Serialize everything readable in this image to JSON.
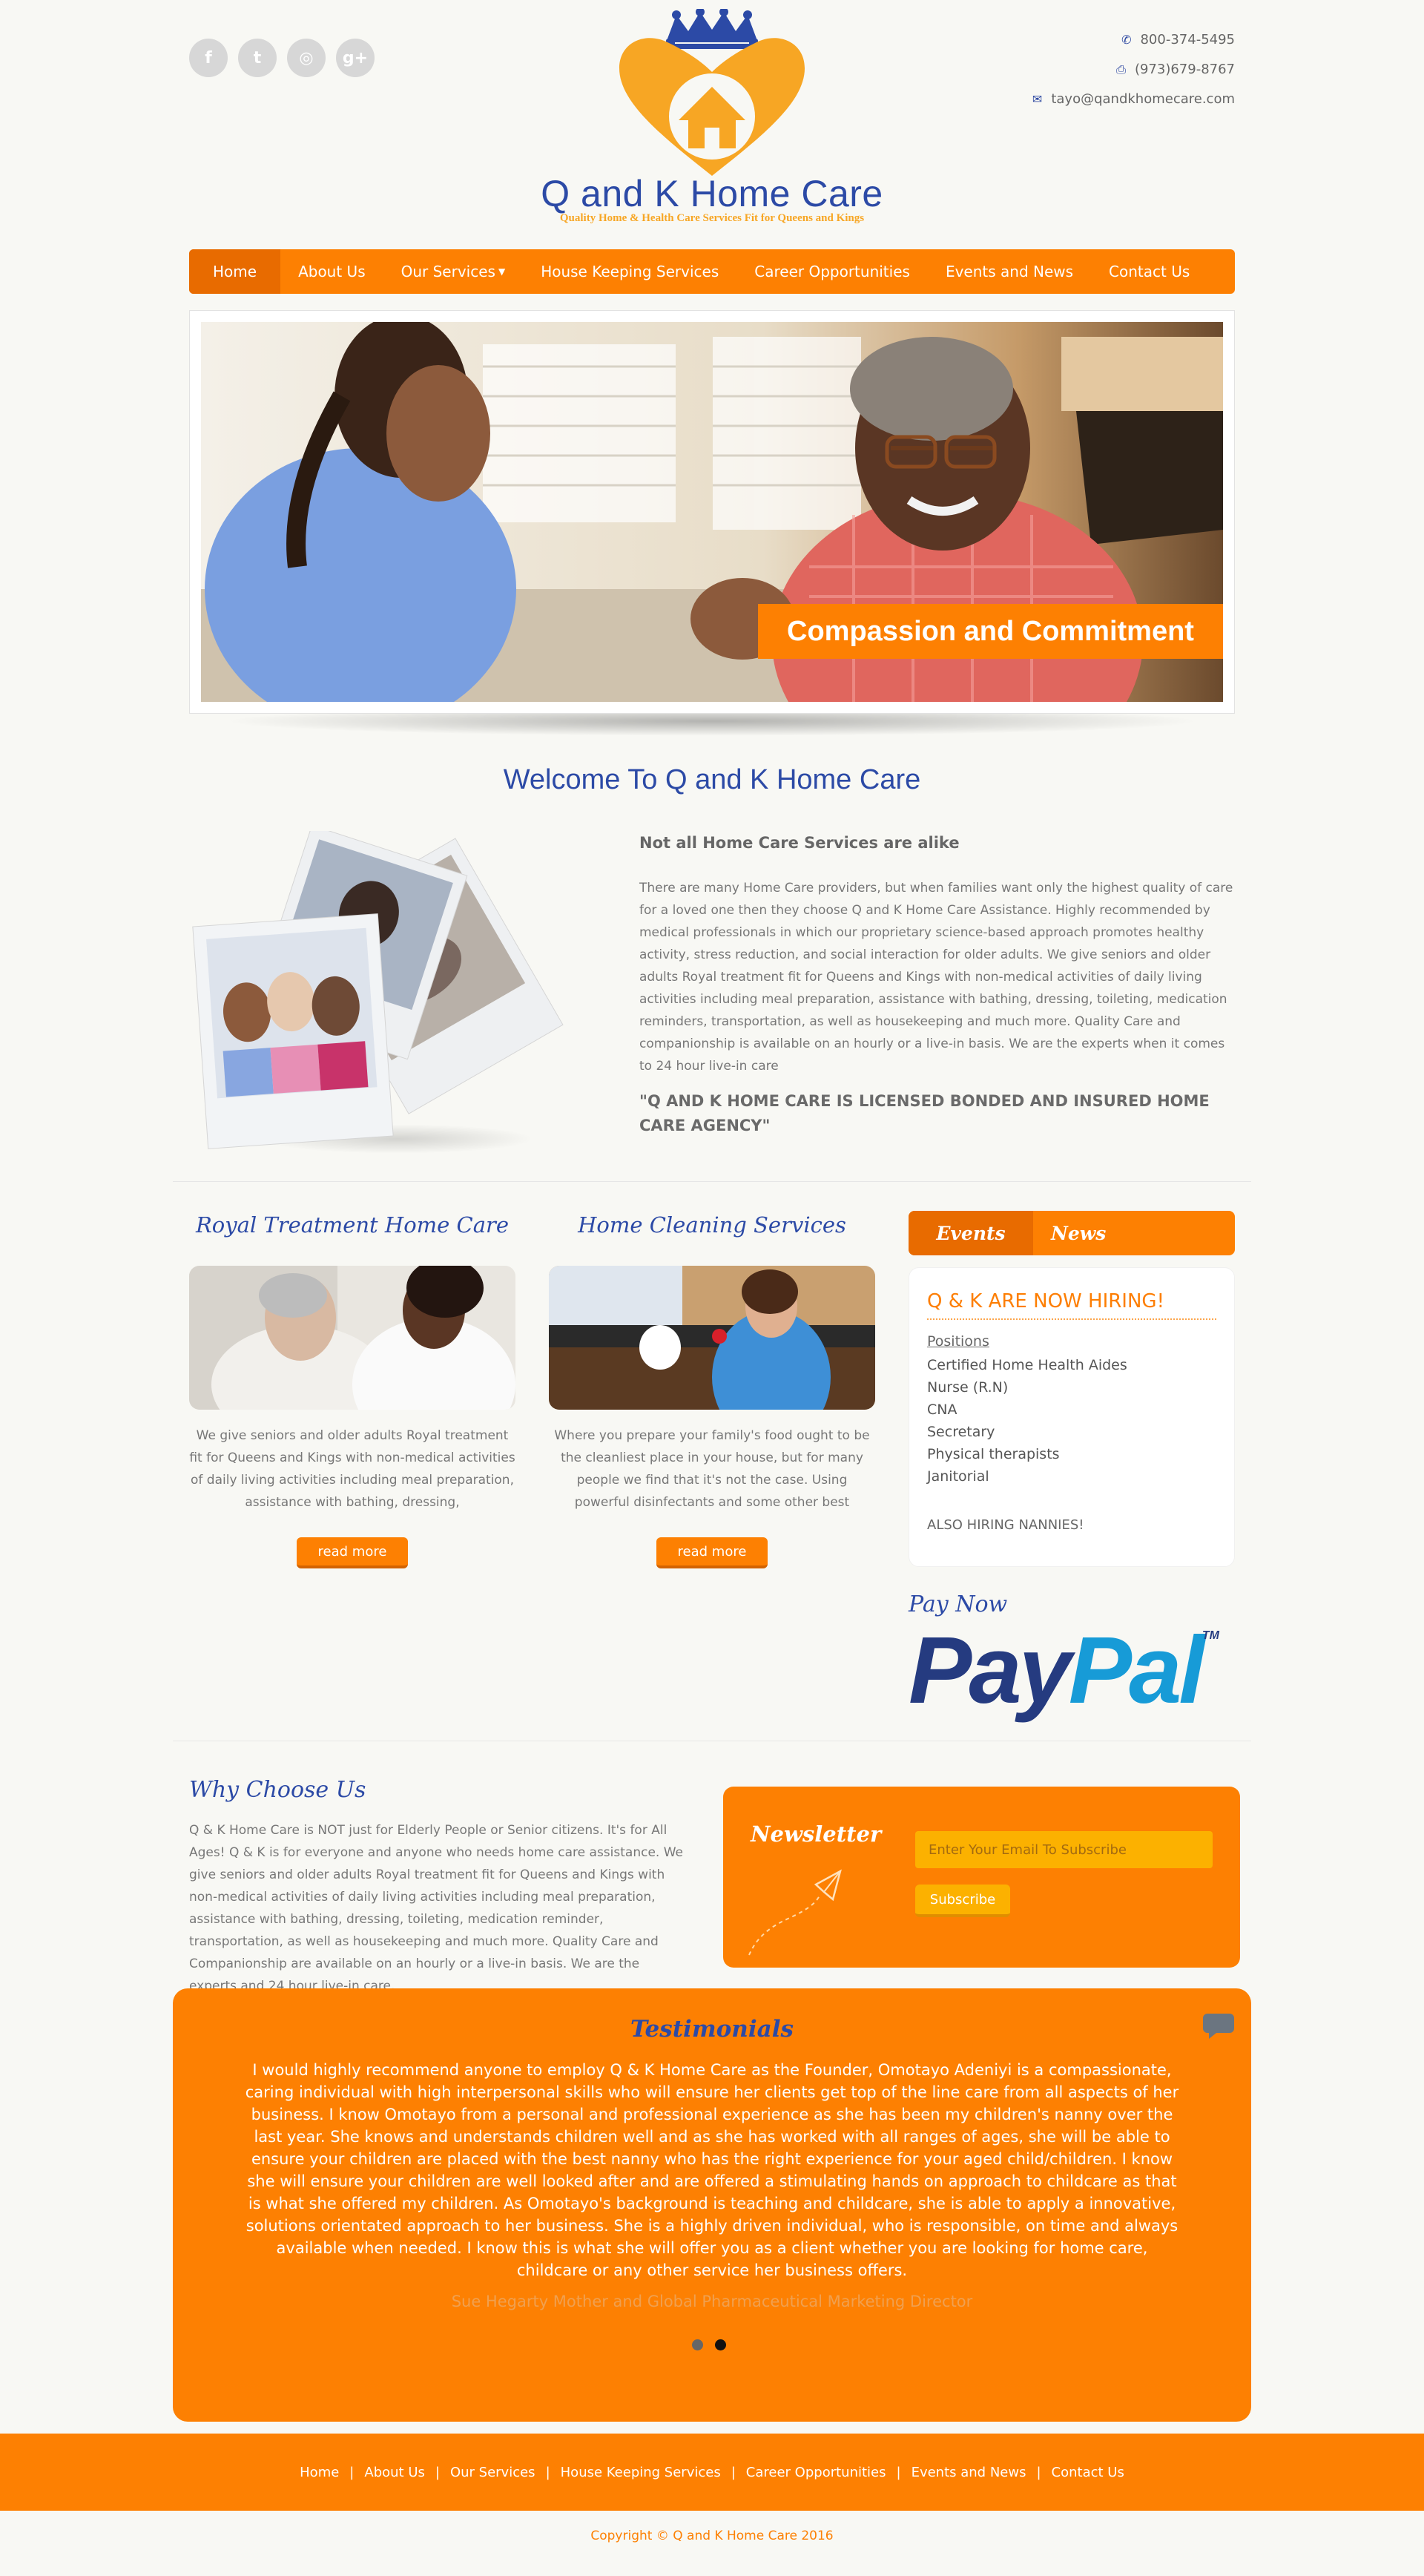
{
  "header": {
    "social": [
      {
        "icon": "facebook-icon",
        "glyph": "f"
      },
      {
        "icon": "twitter-icon",
        "glyph": "t"
      },
      {
        "icon": "instagram-icon",
        "glyph": "◎"
      },
      {
        "icon": "google-plus-icon",
        "glyph": "g+"
      }
    ],
    "logo_name": "Q and K Home Care",
    "logo_tagline": "Quality Home & Health Care Services Fit for Queens and Kings",
    "phone": "800-374-5495",
    "fax": "(973)679-8767",
    "email": "tayo@qandkhomecare.com"
  },
  "nav": {
    "items": [
      "Home",
      "About Us",
      "Our Services",
      "House Keeping Services",
      "Career Opportunities",
      "Events and News",
      "Contact Us"
    ],
    "active": "Home"
  },
  "slider": {
    "caption": "Compassion and Commitment"
  },
  "welcome": {
    "title": "Welcome To Q and K Home Care",
    "subtitle": "Not all Home Care Services are alike",
    "body": "There are many Home Care providers, but when families want only the highest quality of care for a loved one then they choose Q and K Home Care Assistance. Highly recommended by medical professionals in which our proprietary science-based approach promotes healthy activity, stress reduction, and social interaction for older adults. We give seniors and older adults Royal treatment fit for Queens and Kings with non-medical activities of daily living activities including meal preparation, assistance with bathing, dressing, toileting, medication reminders, transportation, as well as housekeeping and much more. Quality Care and companionship is available on an hourly or a live-in basis. We are the experts when it comes to 24 hour live-in care",
    "quote": "\"Q AND K HOME CARE IS LICENSED BONDED AND INSURED HOME CARE AGENCY\""
  },
  "services": [
    {
      "title": "Royal Treatment Home Care",
      "text": "We give seniors and older adults Royal treatment fit for Queens and Kings with non-medical activities of daily living activities including meal preparation, assistance with bathing, dressing,",
      "button": "read more"
    },
    {
      "title": "Home Cleaning Services",
      "text": "Where you prepare your family's food ought to be the cleanliest place in your house, but for many people we find that it's not the case. Using powerful disinfectants and some other best",
      "button": "read more"
    }
  ],
  "events": {
    "tabs": [
      "Events",
      "News"
    ],
    "heading": "Q & K ARE NOW HIRING!",
    "positions_label": "Positions",
    "positions": [
      "Certified Home Health Aides",
      "Nurse (R.N)",
      "CNA",
      "Secretary",
      "Physical therapists",
      "Janitorial"
    ],
    "also": "ALSO HIRING  NANNIES!"
  },
  "pay": {
    "title": "Pay Now",
    "brand_a": "Pay",
    "brand_b": "Pal",
    "tm": "TM"
  },
  "why": {
    "title": "Why Choose Us",
    "text": "Q & K Home Care is NOT just for Elderly People or Senior citizens. It's for All Ages! Q & K is for everyone and anyone who needs home care assistance. We give seniors and older adults Royal treatment fit for Queens and Kings with non-medical activities of daily living activities including meal preparation, assistance with bathing, dressing, toileting, medication reminder, transportation, as well as housekeeping and much more. Quality Care and Companionship are available on an hourly or a live-in basis. We are the experts and 24 hour live-in care."
  },
  "newsletter": {
    "title": "Newsletter",
    "placeholder": "Enter Your Email To Subscribe",
    "button": "Subscribe"
  },
  "testimonials": {
    "title": "Testimonials",
    "body": "I would highly recommend anyone to employ Q & K Home Care as the Founder, Omotayo Adeniyi is a compassionate, caring individual with high interpersonal skills who will ensure her clients get top of the line care from all aspects of her business. I know Omotayo from a personal and professional experience as she has been my children's nanny over the last year. She knows and understands children well and as she has worked with all ranges of ages, she will be able to ensure your children are placed with the best nanny who has the right experience for your aged child/children. I know she will ensure your children are well looked after and are offered a stimulating hands on approach to childcare as that is what she offered my children. As Omotayo's background is teaching and childcare, she is able to apply a innovative, solutions orientated approach to her business. She is a highly driven individual, who is responsible, on time and always available when needed. I know this is what she will offer you as a client whether you are looking for home care, childcare or any other service her business offers.",
    "author": "Sue Hegarty Mother and Global Pharmaceutical Marketing Director"
  },
  "footer": {
    "links": [
      "Home",
      "About Us",
      "Our Services",
      "House Keeping Services",
      "Career Opportunities",
      "Events and News",
      "Contact Us"
    ],
    "copyright": "Copyright © Q and K Home Care 2016"
  },
  "colors": {
    "accent": "#fd8002",
    "brand_blue": "#2c4aa6",
    "logo_gold": "#f7a624"
  }
}
